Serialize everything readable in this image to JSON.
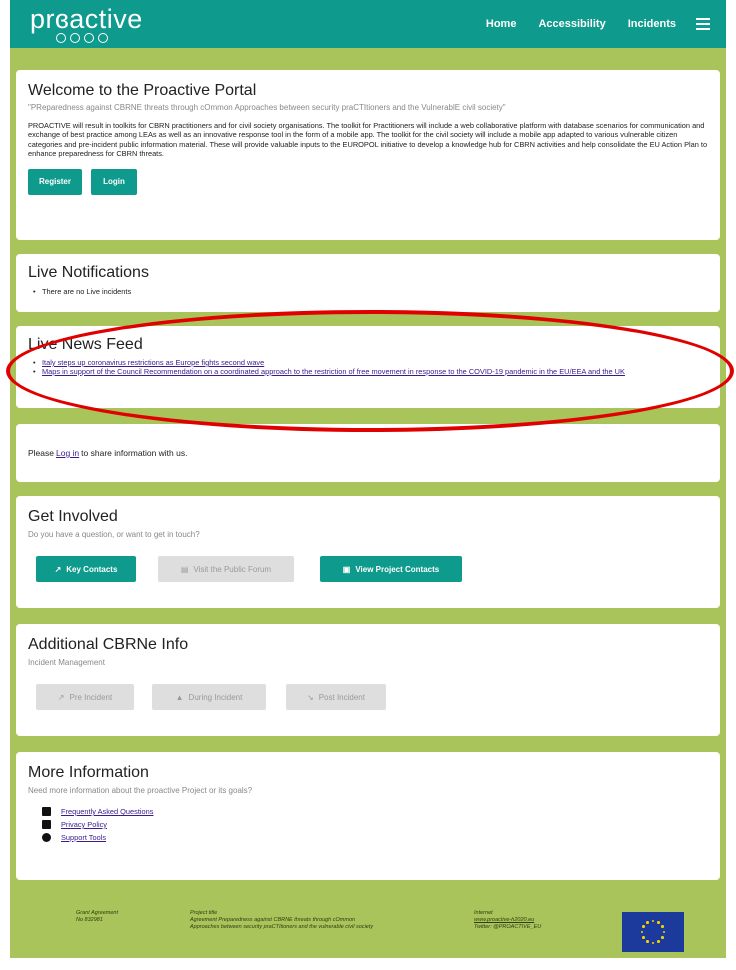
{
  "header": {
    "logo": "prɞactive",
    "nav": [
      "Home",
      "Accessibility",
      "Incidents"
    ]
  },
  "welcome": {
    "title": "Welcome to the Proactive Portal",
    "tagline": "\"PReparedness against CBRNE threats through cOmmon Approaches between security praCTItioners and the VulnerablE civil society\"",
    "body": "PROACTIVE will result in toolkits for CBRN practitioners and for civil society organisations. The toolkit for Practitioners will include a web collaborative platform with database scenarios for communication and exchange of best practice among LEAs as well as an innovative response tool in the form of a mobile app. The toolkit for the civil society will include a mobile app adapted to various vulnerable citizen categories and pre-incident public information material. These will provide valuable inputs to the EUROPOL initiative to develop a knowledge hub for CBRN activities and help consolidate the EU Action Plan to enhance preparedness for CBRN threats.",
    "register_label": "Register",
    "login_label": "Login"
  },
  "notifications": {
    "title": "Live Notifications",
    "items": [
      "There are no Live incidents"
    ]
  },
  "news": {
    "title": "Live News Feed",
    "items": [
      "Italy steps up coronavirus restrictions as Europe fights second wave",
      "Maps in support of the Council Recommendation on a coordinated approach to the restriction of free movement in response to the COVID-19 pandemic in the EU/EEA and the UK"
    ]
  },
  "share": {
    "prefix": "Please ",
    "link": "Log in",
    "suffix": " to share information with us."
  },
  "involved": {
    "title": "Get Involved",
    "subtitle": "Do you have a question, or want to get in touch?",
    "buttons": [
      "Key Contacts",
      "Visit the Public Forum",
      "View Project Contacts"
    ]
  },
  "cbrne": {
    "title": "Additional CBRNe Info",
    "subtitle": "Incident Management",
    "buttons": [
      "Pre Incident",
      "During Incident",
      "Post Incident"
    ]
  },
  "more": {
    "title": "More Information",
    "subtitle": "Need more information about the proactive Project or its goals?",
    "links": [
      "Frequently Asked Questions",
      "Privacy Policy",
      "Support Tools"
    ]
  },
  "footer": {
    "grant": [
      "Grant Agreement",
      "No 832981"
    ],
    "project": [
      "Project title",
      "Agreement Preparedness against CBRNE threats through cOmmon",
      "Approaches between security praCTItioners and the vulnerable civil society"
    ],
    "internet": [
      "Internet",
      "www.proactive-h2020.eu",
      "Twitter: @PROACTIVE_EU"
    ]
  },
  "colors": {
    "brand": "#0e9a8c",
    "background": "#a9c45a",
    "highlight": "#e00000"
  }
}
